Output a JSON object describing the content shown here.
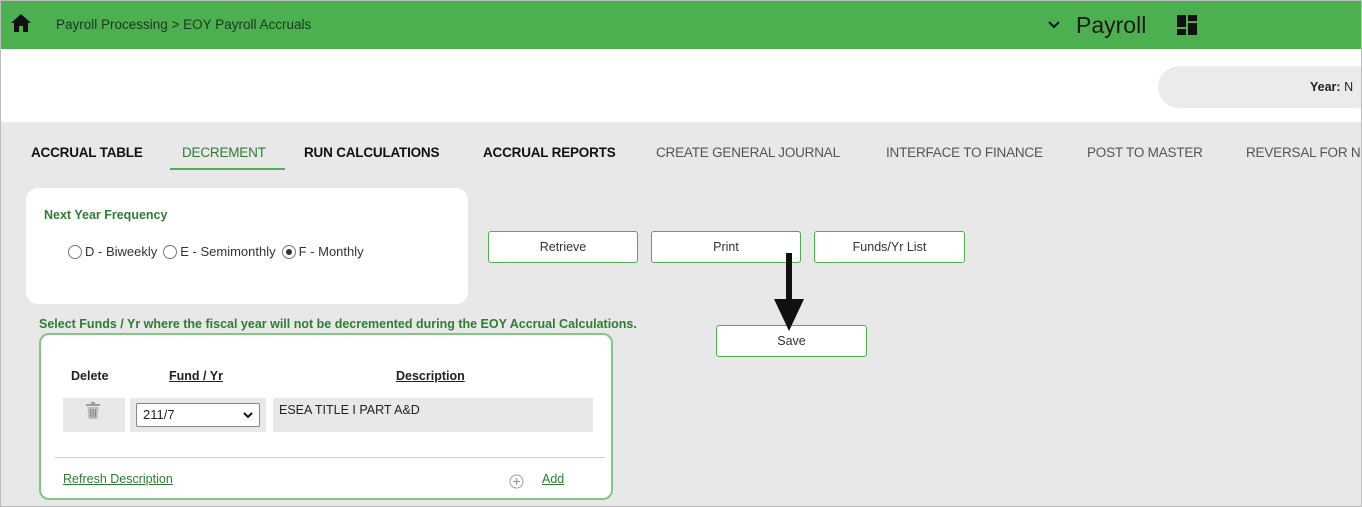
{
  "header": {
    "breadcrumb": "Payroll Processing > EOY Payroll Accruals",
    "module": "Payroll",
    "icons": [
      "home-icon",
      "chevron-down-icon",
      "grid-menu-icon"
    ],
    "brand_color": "#4caf50"
  },
  "subheader": {
    "year_label": "Year:",
    "year_value": "N"
  },
  "tabs": [
    {
      "label": "ACCRUAL TABLE"
    },
    {
      "label": "DECREMENT",
      "active": true
    },
    {
      "label": "RUN CALCULATIONS"
    },
    {
      "label": "ACCRUAL REPORTS"
    },
    {
      "label": "CREATE GENERAL JOURNAL"
    },
    {
      "label": "INTERFACE TO FINANCE"
    },
    {
      "label": "POST TO MASTER"
    },
    {
      "label": "REVERSAL FOR N"
    }
  ],
  "frequency": {
    "title": "Next Year Frequency",
    "options": [
      {
        "label": "D - Biweekly",
        "checked": false
      },
      {
        "label": "E - Semimonthly",
        "checked": false
      },
      {
        "label": "F - Monthly",
        "checked": true
      }
    ]
  },
  "buttons": {
    "retrieve": "Retrieve",
    "print": "Print",
    "funds_list": "Funds/Yr List",
    "save": "Save"
  },
  "funds": {
    "note": "Select Funds / Yr where the fiscal year will not be decremented during the EOY Accrual Calculations.",
    "columns": {
      "delete": "Delete",
      "fund_yr": "Fund / Yr",
      "description": "Description"
    },
    "rows": [
      {
        "fund_yr": "211/7",
        "description": "ESEA TITLE I PART A&D"
      }
    ],
    "refresh_label": "Refresh Description",
    "add_label": "Add"
  }
}
